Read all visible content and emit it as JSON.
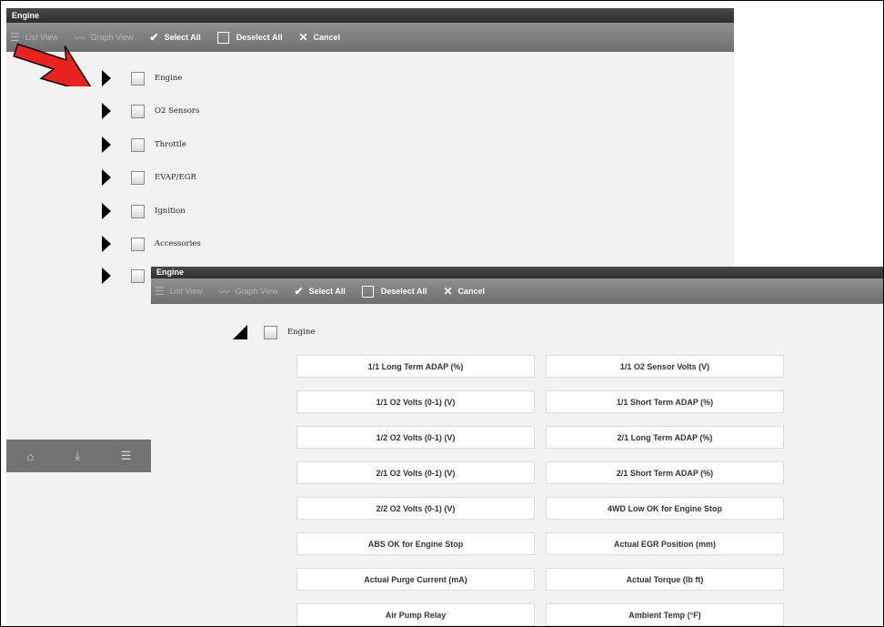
{
  "back_window": {
    "title": "Engine",
    "toolbar": {
      "list_view": "List View",
      "graph_view": "Graph View",
      "select_all": "Select All",
      "deselect_all": "Deselect All",
      "cancel": "Cancel"
    },
    "categories": [
      "Engine",
      "O2 Sensors",
      "Throttle",
      "EVAP/EGR",
      "Ignition",
      "Accessories",
      ""
    ]
  },
  "front_window": {
    "title": "Engine",
    "toolbar": {
      "list_view": "List View",
      "graph_view": "Graph View",
      "select_all": "Select All",
      "deselect_all": "Deselect All",
      "cancel": "Cancel"
    },
    "group_label": "Engine",
    "pids": [
      "1/1 Long Term ADAP (%)",
      "1/1 O2 Sensor Volts (V)",
      "1/1 O2 Volts (0-1) (V)",
      "1/1 Short Term ADAP (%)",
      "1/2 O2 Volts (0-1) (V)",
      "2/1 Long Term ADAP (%)",
      "2/1 O2 Volts (0-1) (V)",
      "2/1 Short Term ADAP (%)",
      "2/2 O2 Volts (0-1) (V)",
      "4WD Low OK for Engine Stop",
      "ABS OK for Engine Stop",
      "Actual EGR Position (mm)",
      "Actual Purge Current (mA)",
      "Actual Torque (lb ft)",
      "Air Pump Relay",
      "Ambient Temp (°F)"
    ]
  },
  "icons": {
    "list_view": "list-icon",
    "graph_view": "graph-icon",
    "select_all": "check-icon",
    "deselect_all": "checkbox-icon",
    "cancel": "close-icon",
    "callout": "red-arrow-icon",
    "footer": [
      "home-icon",
      "save-icon",
      "filter-icon"
    ]
  },
  "colors": {
    "callout_arrow": "#e8231f",
    "toolbar": "#7d7e7f",
    "titlebar": "#3a3a3a"
  }
}
